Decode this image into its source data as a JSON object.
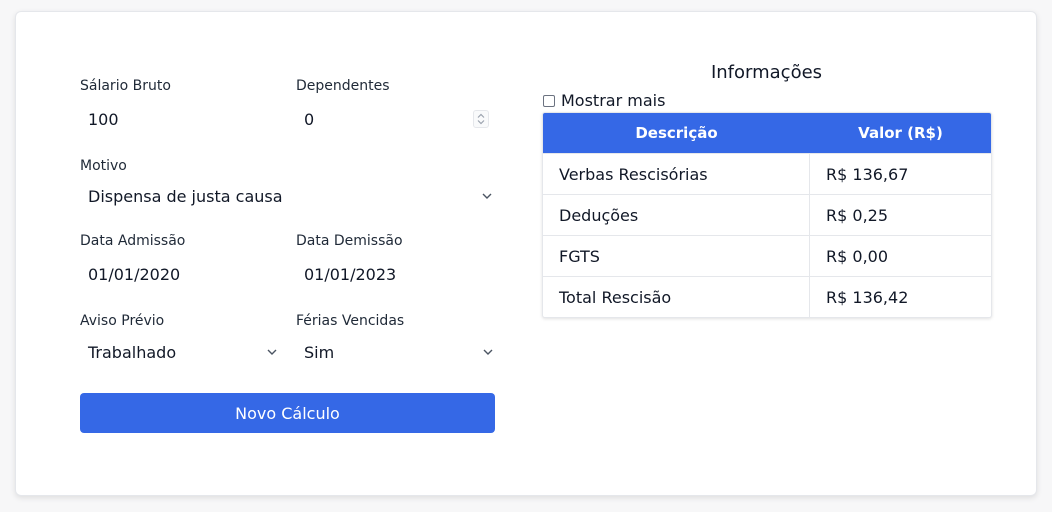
{
  "form": {
    "salario_label": "Sálario Bruto",
    "salario_value": "100",
    "dependentes_label": "Dependentes",
    "dependentes_value": "0",
    "motivo_label": "Motivo",
    "motivo_value": "Dispensa de justa causa",
    "admissao_label": "Data Admissão",
    "admissao_value": "01/01/2020",
    "demissao_label": "Data Demissão",
    "demissao_value": "01/01/2023",
    "aviso_label": "Aviso Prévio",
    "aviso_value": "Trabalhado",
    "ferias_label": "Férias Vencidas",
    "ferias_value": "Sim",
    "button_label": "Novo Cálculo"
  },
  "info": {
    "title": "Informações",
    "show_more_label": "Mostrar mais",
    "show_more_checked": false,
    "columns": [
      "Descrição",
      "Valor (R$)"
    ],
    "rows": [
      {
        "descricao": "Verbas Rescisórias",
        "valor": "R$ 136,67"
      },
      {
        "descricao": "Deduções",
        "valor": "R$ 0,25"
      },
      {
        "descricao": "FGTS",
        "valor": "R$ 0,00"
      },
      {
        "descricao": "Total Rescisão",
        "valor": "R$ 136,42"
      }
    ]
  },
  "colors": {
    "accent": "#3568e6",
    "card_background": "#ffffff",
    "page_background": "#f7f7f8"
  },
  "icons": {
    "select_arrow": "chevron-down-icon",
    "number_spinner": "spinner-icon",
    "checkbox": "checkbox-icon"
  }
}
